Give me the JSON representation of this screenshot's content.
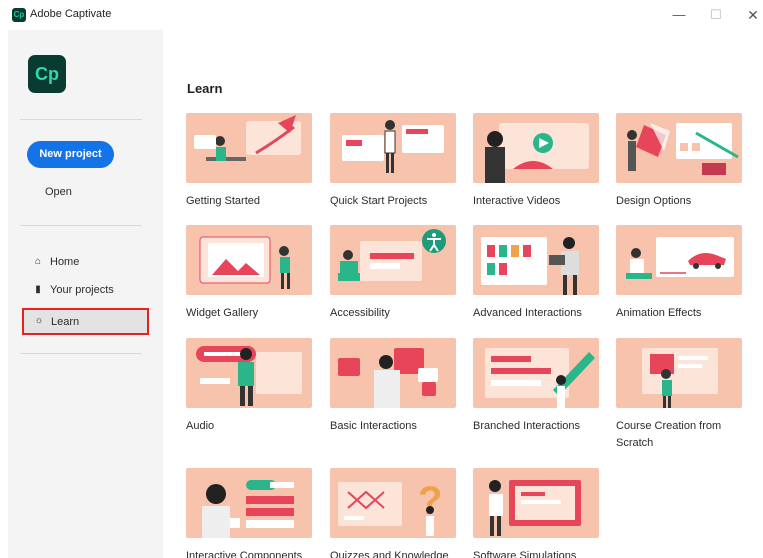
{
  "window": {
    "title": "Adobe Captivate",
    "app_icon_text": "Cp",
    "minimize_glyph": "—",
    "maximize_glyph": "☐",
    "close_glyph": "✕"
  },
  "sidebar": {
    "logo_text": "Cp",
    "new_project_label": "New project",
    "open_label": "Open",
    "nav": [
      {
        "label": "Home",
        "icon": "home-icon",
        "glyph": "⌂"
      },
      {
        "label": "Your projects",
        "icon": "document-icon",
        "glyph": "▮"
      },
      {
        "label": "Learn",
        "icon": "lightbulb-icon",
        "glyph": "☼",
        "selected": true
      }
    ]
  },
  "main": {
    "title": "Learn",
    "cards": [
      {
        "label": "Getting Started"
      },
      {
        "label": "Quick Start Projects"
      },
      {
        "label": "Interactive Videos"
      },
      {
        "label": "Design Options"
      },
      {
        "label": "Widget Gallery"
      },
      {
        "label": "Accessibility"
      },
      {
        "label": "Advanced Interactions"
      },
      {
        "label": "Animation Effects"
      },
      {
        "label": "Audio"
      },
      {
        "label": "Basic Interactions"
      },
      {
        "label": "Branched Interactions"
      },
      {
        "label": "Course Creation from Scratch"
      },
      {
        "label": "Interactive Components"
      },
      {
        "label": "Quizzes and Knowledge"
      },
      {
        "label": "Software Simulations"
      }
    ]
  },
  "colors": {
    "accent": "#1473e6",
    "thumb_bg": "#f8c3ad",
    "highlight_border": "#e32323",
    "brand_dark": "#0a3b32",
    "brand_green": "#32d6a8"
  }
}
